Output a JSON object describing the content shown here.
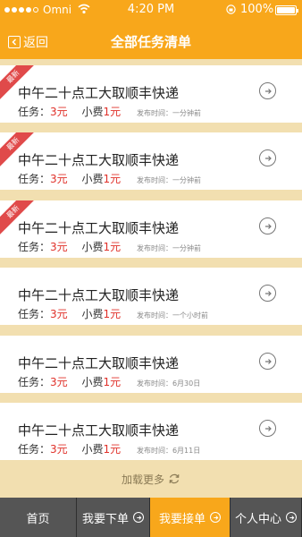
{
  "status_bar": {
    "carrier": "Omni",
    "time": "4:20 PM",
    "battery": "100%"
  },
  "header": {
    "back_label": "返回",
    "title": "全部任务清单"
  },
  "tasks": [
    {
      "title": "中午二十点工大取顺丰快递",
      "task_label": "任务：",
      "task_price": "3元",
      "fee_label": "小费",
      "fee_price": "1元",
      "publish_time": "发布时间：一分钟前",
      "badge": "最新"
    },
    {
      "title": "中午二十点工大取顺丰快递",
      "task_label": "任务：",
      "task_price": "3元",
      "fee_label": "小费",
      "fee_price": "1元",
      "publish_time": "发布时间：一分钟前",
      "badge": "最新"
    },
    {
      "title": "中午二十点工大取顺丰快递",
      "task_label": "任务：",
      "task_price": "3元",
      "fee_label": "小费",
      "fee_price": "1元",
      "publish_time": "发布时间：一分钟前",
      "badge": "最新"
    },
    {
      "title": "中午二十点工大取顺丰快递",
      "task_label": "任务：",
      "task_price": "3元",
      "fee_label": "小费",
      "fee_price": "1元",
      "publish_time": "发布时间：一个小时前",
      "badge": ""
    },
    {
      "title": "中午二十点工大取顺丰快递",
      "task_label": "任务：",
      "task_price": "3元",
      "fee_label": "小费",
      "fee_price": "1元",
      "publish_time": "发布时间：6月30日",
      "badge": ""
    },
    {
      "title": "中午二十点工大取顺丰快递",
      "task_label": "任务：",
      "task_price": "3元",
      "fee_label": "小费",
      "fee_price": "1元",
      "publish_time": "发布时间：6月11日",
      "badge": ""
    }
  ],
  "load_more": "加载更多",
  "tabs": [
    {
      "label": "首页",
      "active": false
    },
    {
      "label": "我要下单",
      "active": false
    },
    {
      "label": "我要接单",
      "active": true
    },
    {
      "label": "个人中心",
      "active": false
    }
  ],
  "colors": {
    "accent": "#f8a71b",
    "background": "#f2dfb0",
    "price_red": "#e0312a",
    "badge_red": "#e04a4a",
    "tabbar": "#555555"
  },
  "icons": {
    "back": "back-arrow-icon",
    "item_arrow": "circle-arrow-right-icon",
    "refresh": "refresh-icon"
  }
}
